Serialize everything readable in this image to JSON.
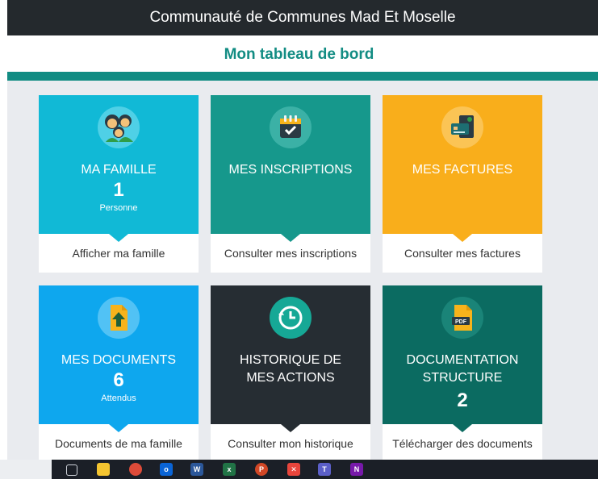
{
  "header": {
    "title": "Communauté de Communes Mad Et Moselle"
  },
  "dashboard": {
    "title": "Mon tableau de bord"
  },
  "cards": [
    {
      "title": "MA FAMILLE",
      "count": "1",
      "unit": "Personne",
      "link": "Afficher ma famille",
      "color": "#11b9d6",
      "icon": "family-icon"
    },
    {
      "title": "MES INSCRIPTIONS",
      "count": "",
      "unit": "",
      "link": "Consulter mes inscriptions",
      "color": "#16988c",
      "icon": "calendar-check-icon"
    },
    {
      "title": "MES FACTURES",
      "count": "",
      "unit": "",
      "link": "Consulter mes factures",
      "color": "#f9ae1b",
      "icon": "invoice-icon"
    },
    {
      "title": "MES DOCUMENTS",
      "count": "6",
      "unit": "Attendus",
      "link": "Documents de ma famille",
      "color": "#0ea7ee",
      "icon": "document-upload-icon"
    },
    {
      "title": "HISTORIQUE DE\nMES ACTIONS",
      "count": "",
      "unit": "",
      "link": "Consulter mon historique",
      "color": "#262d33",
      "icon": "history-icon"
    },
    {
      "title": "DOCUMENTATION\nSTRUCTURE",
      "count": "2",
      "unit": "",
      "link": "Télécharger des documents",
      "color": "#0b6b61",
      "icon": "pdf-icon"
    }
  ],
  "taskbar": {
    "apps": [
      "task-view-icon",
      "file-explorer-icon",
      "chrome-icon",
      "outlook-icon",
      "word-icon",
      "excel-icon",
      "powerpoint-icon",
      "xmind-icon",
      "teams-icon",
      "onenote-icon"
    ]
  }
}
